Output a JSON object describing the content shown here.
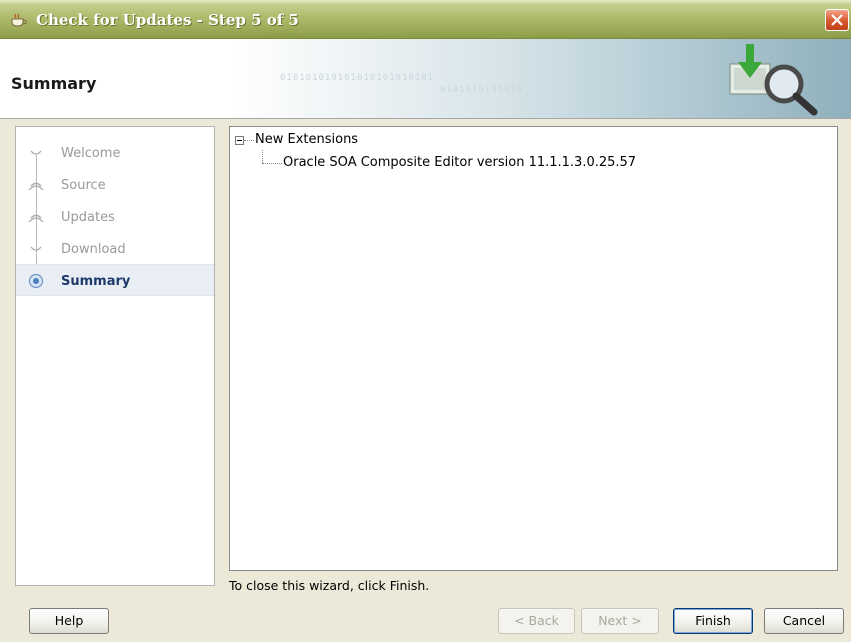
{
  "window": {
    "title": "Check for Updates - Step 5 of 5"
  },
  "header": {
    "title": "Summary",
    "banner_binary_1": "010101010101010101010101",
    "banner_binary_2": "0101010101010"
  },
  "nav": {
    "items": [
      {
        "label": "Welcome",
        "state": "completed"
      },
      {
        "label": "Source",
        "state": "completed"
      },
      {
        "label": "Updates",
        "state": "completed"
      },
      {
        "label": "Download",
        "state": "completed"
      },
      {
        "label": "Summary",
        "state": "current"
      }
    ]
  },
  "tree": {
    "root_label": "New Extensions",
    "children": [
      {
        "label": "Oracle SOA Composite Editor version 11.1.1.3.0.25.57"
      }
    ]
  },
  "hint": "To close this wizard, click Finish.",
  "buttons": {
    "help": "Help",
    "back": "< Back",
    "next": "Next >",
    "finish": "Finish",
    "cancel": "Cancel"
  },
  "colors": {
    "titlebar": "#9aa955",
    "close": "#d8582f",
    "nav_active_text": "#1e3a6b",
    "nav_inactive_text": "#9a9a9a"
  }
}
